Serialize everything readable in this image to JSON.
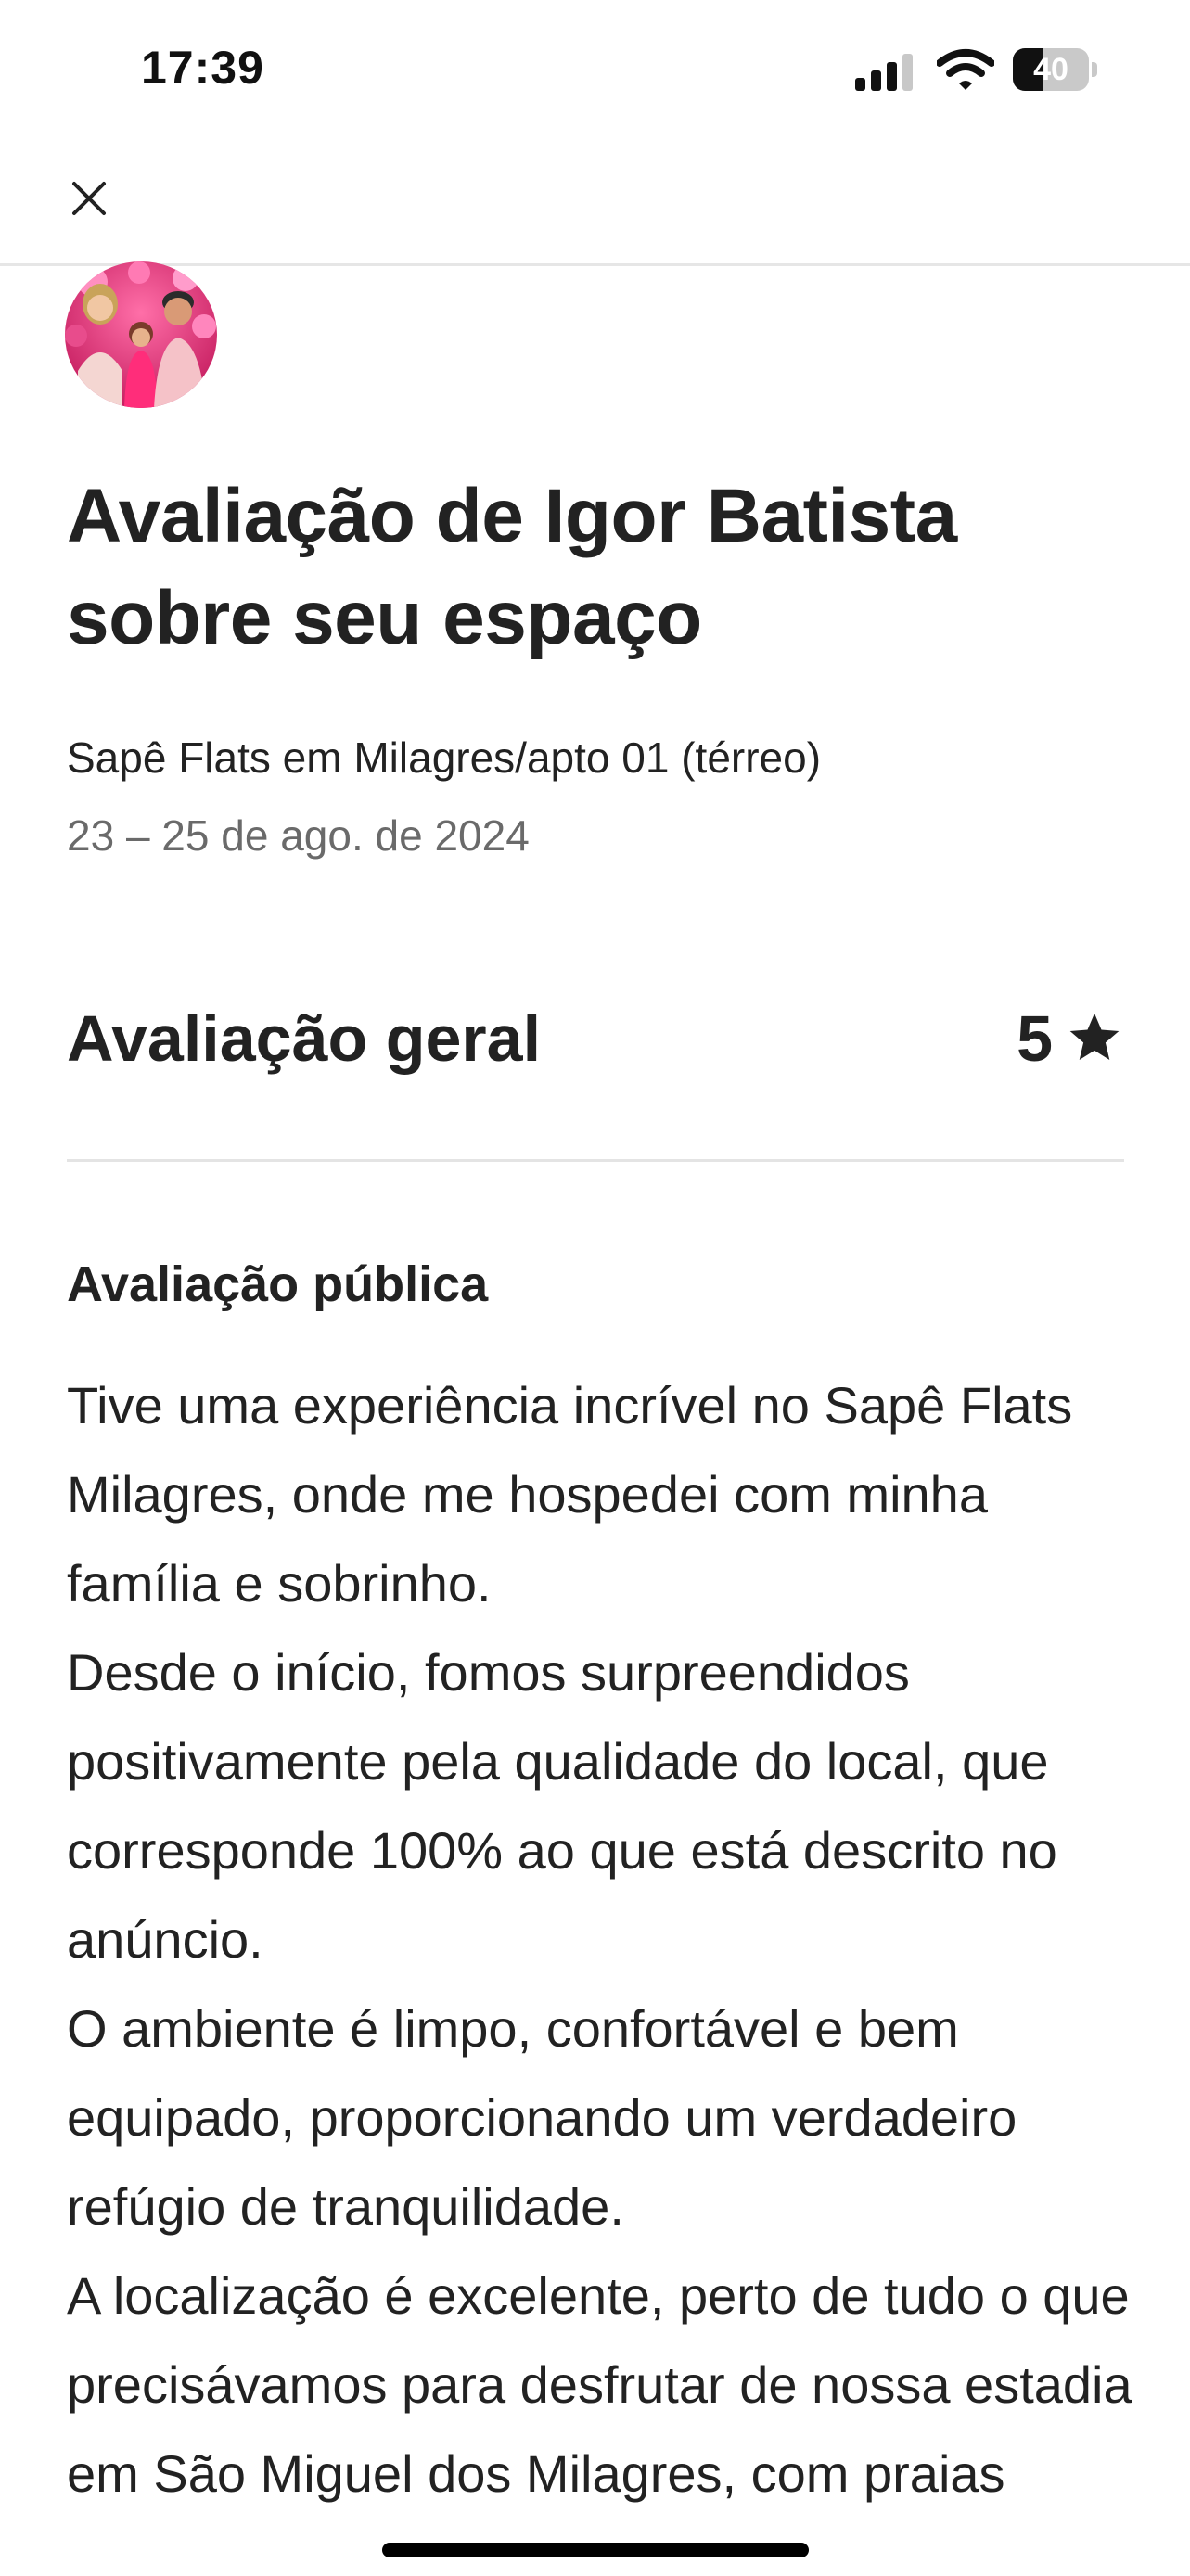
{
  "status_bar": {
    "time": "17:39",
    "battery": "40",
    "battery_level": 0.4,
    "icons": [
      "cellular-signal-icon",
      "wifi-icon",
      "battery-icon"
    ]
  },
  "header": {
    "close_icon": "close-icon"
  },
  "review": {
    "title": "Avaliação de Igor Batista sobre seu espaço",
    "listing": "Sapê Flats em Milagres/apto 01 (térreo)",
    "dates": "23 – 25 de ago. de 2024",
    "overall_label": "Avaliação geral",
    "overall_rating": "5",
    "rating_icon": "star-icon",
    "public_heading": "Avaliação pública",
    "paragraphs": [
      "Tive uma experiência incrível no Sapê Flats Milagres, onde me hospedei com minha família e sobrinho.",
      "Desde o início, fomos surpreendidos positivamente pela qualidade do local, que corresponde 100% ao que está descrito no anúncio.",
      "O ambiente é limpo, confortável e bem equipado, proporcionando um verdadeiro refúgio de tranquilidade.",
      "A localização é excelente, perto de tudo o que precisávamos para desfrutar de nossa estadia em São Miguel dos Milagres, com praias"
    ]
  },
  "colors": {
    "text_primary": "#222222",
    "text_secondary": "#6a6a6a",
    "divider": "#e4e4e4",
    "background": "#ffffff"
  }
}
